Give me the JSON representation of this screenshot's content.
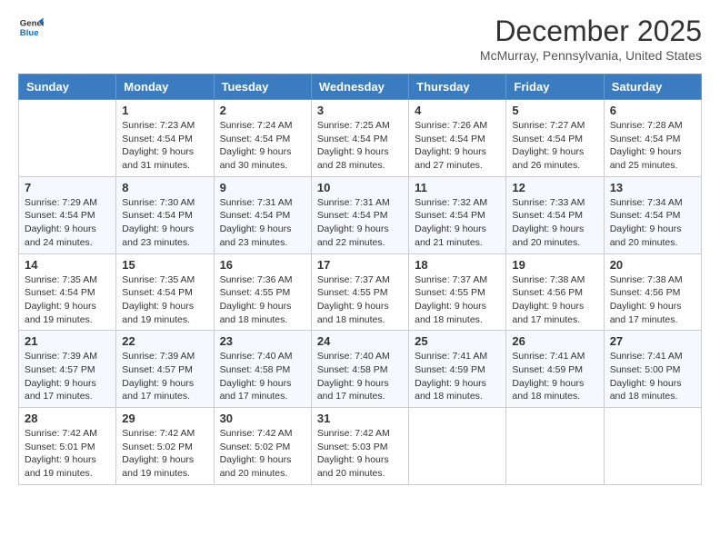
{
  "header": {
    "logo_line1": "General",
    "logo_line2": "Blue",
    "month_title": "December 2025",
    "location": "McMurray, Pennsylvania, United States"
  },
  "weekdays": [
    "Sunday",
    "Monday",
    "Tuesday",
    "Wednesday",
    "Thursday",
    "Friday",
    "Saturday"
  ],
  "weeks": [
    [
      {
        "day": "",
        "sunrise": "",
        "sunset": "",
        "daylight": ""
      },
      {
        "day": "1",
        "sunrise": "Sunrise: 7:23 AM",
        "sunset": "Sunset: 4:54 PM",
        "daylight": "Daylight: 9 hours and 31 minutes."
      },
      {
        "day": "2",
        "sunrise": "Sunrise: 7:24 AM",
        "sunset": "Sunset: 4:54 PM",
        "daylight": "Daylight: 9 hours and 30 minutes."
      },
      {
        "day": "3",
        "sunrise": "Sunrise: 7:25 AM",
        "sunset": "Sunset: 4:54 PM",
        "daylight": "Daylight: 9 hours and 28 minutes."
      },
      {
        "day": "4",
        "sunrise": "Sunrise: 7:26 AM",
        "sunset": "Sunset: 4:54 PM",
        "daylight": "Daylight: 9 hours and 27 minutes."
      },
      {
        "day": "5",
        "sunrise": "Sunrise: 7:27 AM",
        "sunset": "Sunset: 4:54 PM",
        "daylight": "Daylight: 9 hours and 26 minutes."
      },
      {
        "day": "6",
        "sunrise": "Sunrise: 7:28 AM",
        "sunset": "Sunset: 4:54 PM",
        "daylight": "Daylight: 9 hours and 25 minutes."
      }
    ],
    [
      {
        "day": "7",
        "sunrise": "Sunrise: 7:29 AM",
        "sunset": "Sunset: 4:54 PM",
        "daylight": "Daylight: 9 hours and 24 minutes."
      },
      {
        "day": "8",
        "sunrise": "Sunrise: 7:30 AM",
        "sunset": "Sunset: 4:54 PM",
        "daylight": "Daylight: 9 hours and 23 minutes."
      },
      {
        "day": "9",
        "sunrise": "Sunrise: 7:31 AM",
        "sunset": "Sunset: 4:54 PM",
        "daylight": "Daylight: 9 hours and 23 minutes."
      },
      {
        "day": "10",
        "sunrise": "Sunrise: 7:31 AM",
        "sunset": "Sunset: 4:54 PM",
        "daylight": "Daylight: 9 hours and 22 minutes."
      },
      {
        "day": "11",
        "sunrise": "Sunrise: 7:32 AM",
        "sunset": "Sunset: 4:54 PM",
        "daylight": "Daylight: 9 hours and 21 minutes."
      },
      {
        "day": "12",
        "sunrise": "Sunrise: 7:33 AM",
        "sunset": "Sunset: 4:54 PM",
        "daylight": "Daylight: 9 hours and 20 minutes."
      },
      {
        "day": "13",
        "sunrise": "Sunrise: 7:34 AM",
        "sunset": "Sunset: 4:54 PM",
        "daylight": "Daylight: 9 hours and 20 minutes."
      }
    ],
    [
      {
        "day": "14",
        "sunrise": "Sunrise: 7:35 AM",
        "sunset": "Sunset: 4:54 PM",
        "daylight": "Daylight: 9 hours and 19 minutes."
      },
      {
        "day": "15",
        "sunrise": "Sunrise: 7:35 AM",
        "sunset": "Sunset: 4:54 PM",
        "daylight": "Daylight: 9 hours and 19 minutes."
      },
      {
        "day": "16",
        "sunrise": "Sunrise: 7:36 AM",
        "sunset": "Sunset: 4:55 PM",
        "daylight": "Daylight: 9 hours and 18 minutes."
      },
      {
        "day": "17",
        "sunrise": "Sunrise: 7:37 AM",
        "sunset": "Sunset: 4:55 PM",
        "daylight": "Daylight: 9 hours and 18 minutes."
      },
      {
        "day": "18",
        "sunrise": "Sunrise: 7:37 AM",
        "sunset": "Sunset: 4:55 PM",
        "daylight": "Daylight: 9 hours and 18 minutes."
      },
      {
        "day": "19",
        "sunrise": "Sunrise: 7:38 AM",
        "sunset": "Sunset: 4:56 PM",
        "daylight": "Daylight: 9 hours and 17 minutes."
      },
      {
        "day": "20",
        "sunrise": "Sunrise: 7:38 AM",
        "sunset": "Sunset: 4:56 PM",
        "daylight": "Daylight: 9 hours and 17 minutes."
      }
    ],
    [
      {
        "day": "21",
        "sunrise": "Sunrise: 7:39 AM",
        "sunset": "Sunset: 4:57 PM",
        "daylight": "Daylight: 9 hours and 17 minutes."
      },
      {
        "day": "22",
        "sunrise": "Sunrise: 7:39 AM",
        "sunset": "Sunset: 4:57 PM",
        "daylight": "Daylight: 9 hours and 17 minutes."
      },
      {
        "day": "23",
        "sunrise": "Sunrise: 7:40 AM",
        "sunset": "Sunset: 4:58 PM",
        "daylight": "Daylight: 9 hours and 17 minutes."
      },
      {
        "day": "24",
        "sunrise": "Sunrise: 7:40 AM",
        "sunset": "Sunset: 4:58 PM",
        "daylight": "Daylight: 9 hours and 17 minutes."
      },
      {
        "day": "25",
        "sunrise": "Sunrise: 7:41 AM",
        "sunset": "Sunset: 4:59 PM",
        "daylight": "Daylight: 9 hours and 18 minutes."
      },
      {
        "day": "26",
        "sunrise": "Sunrise: 7:41 AM",
        "sunset": "Sunset: 4:59 PM",
        "daylight": "Daylight: 9 hours and 18 minutes."
      },
      {
        "day": "27",
        "sunrise": "Sunrise: 7:41 AM",
        "sunset": "Sunset: 5:00 PM",
        "daylight": "Daylight: 9 hours and 18 minutes."
      }
    ],
    [
      {
        "day": "28",
        "sunrise": "Sunrise: 7:42 AM",
        "sunset": "Sunset: 5:01 PM",
        "daylight": "Daylight: 9 hours and 19 minutes."
      },
      {
        "day": "29",
        "sunrise": "Sunrise: 7:42 AM",
        "sunset": "Sunset: 5:02 PM",
        "daylight": "Daylight: 9 hours and 19 minutes."
      },
      {
        "day": "30",
        "sunrise": "Sunrise: 7:42 AM",
        "sunset": "Sunset: 5:02 PM",
        "daylight": "Daylight: 9 hours and 20 minutes."
      },
      {
        "day": "31",
        "sunrise": "Sunrise: 7:42 AM",
        "sunset": "Sunset: 5:03 PM",
        "daylight": "Daylight: 9 hours and 20 minutes."
      },
      {
        "day": "",
        "sunrise": "",
        "sunset": "",
        "daylight": ""
      },
      {
        "day": "",
        "sunrise": "",
        "sunset": "",
        "daylight": ""
      },
      {
        "day": "",
        "sunrise": "",
        "sunset": "",
        "daylight": ""
      }
    ]
  ]
}
